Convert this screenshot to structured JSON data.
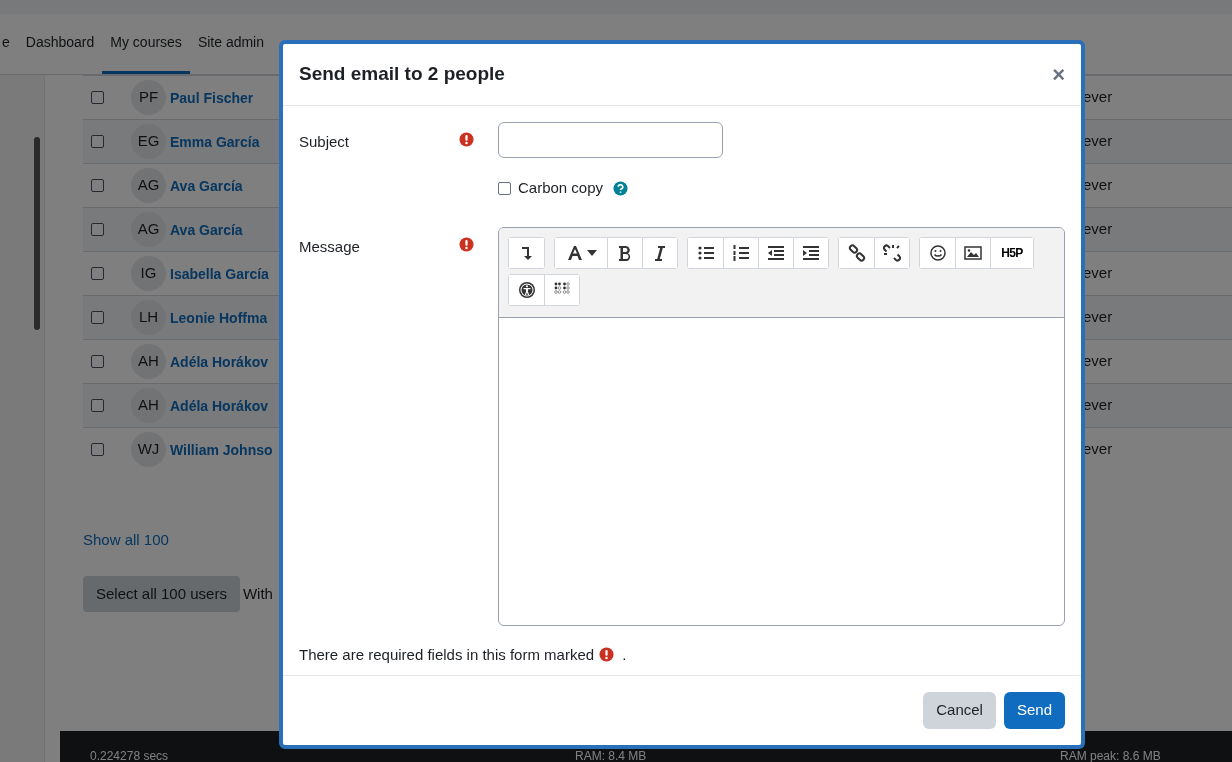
{
  "nav": {
    "items": [
      {
        "label": "e",
        "selected": false
      },
      {
        "label": "Dashboard",
        "selected": false
      },
      {
        "label": "My courses",
        "selected": true
      },
      {
        "label": "Site admin",
        "selected": false
      }
    ]
  },
  "participants": {
    "rows": [
      {
        "checked": false,
        "initials": "PF",
        "name": "Paul Fischer",
        "status": "ever"
      },
      {
        "checked": false,
        "initials": "EG",
        "name": "Emma García",
        "status": "ever"
      },
      {
        "checked": false,
        "initials": "AG",
        "name": "Ava García",
        "status": "ever"
      },
      {
        "checked": false,
        "initials": "AG",
        "name": "Ava García",
        "status": "ever"
      },
      {
        "checked": false,
        "initials": "IG",
        "name": "Isabella García",
        "status": "ever"
      },
      {
        "checked": false,
        "initials": "LH",
        "name": "Leonie Hoffma",
        "status": "ever"
      },
      {
        "checked": false,
        "initials": "AH",
        "name": "Adéla Horákov",
        "status": "ever"
      },
      {
        "checked": false,
        "initials": "AH",
        "name": "Adéla Horákov",
        "status": "ever"
      },
      {
        "checked": false,
        "initials": "WJ",
        "name": "William Johnso",
        "status": "ever"
      }
    ],
    "show_all_link": "Show all 100",
    "select_all_button": "Select all 100 users",
    "with_selected": "With"
  },
  "footer": {
    "time": "0.224278 secs",
    "ram": "RAM: 8.4 MB",
    "ram_peak": "RAM peak: 8.6 MB"
  },
  "modal": {
    "title": "Send email to 2 people",
    "close": "×",
    "subject": {
      "label": "Subject",
      "required": true
    },
    "carbon_copy": {
      "label": "Carbon copy",
      "checked": false
    },
    "message": {
      "label": "Message",
      "required": true
    },
    "required_note": "There are required fields in this form marked",
    "required_note_end": ".",
    "toolbar_logo": "H5P",
    "buttons": {
      "cancel": "Cancel",
      "send": "Send"
    }
  }
}
